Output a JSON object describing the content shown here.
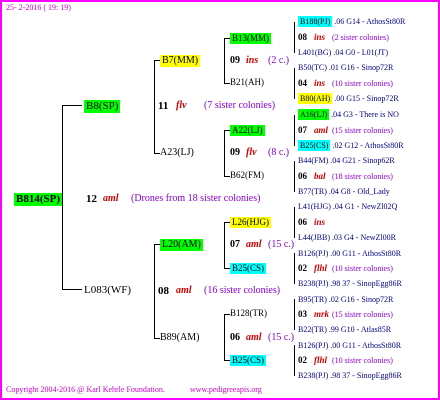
{
  "header": {
    "date": "25- 2-2016 ( 19: 19)"
  },
  "footer": {
    "copyright": "Copyright 2004-2016 @ Karl Kehrle Foundation.",
    "url": "www.pedigreeapis.org"
  },
  "root": {
    "id": "B814(SP)",
    "num": "12",
    "ins": "aml",
    "note": "(Drones from 18 sister colonies)"
  },
  "gen1": [
    {
      "id": "B8(SP)",
      "num": "11",
      "ins": "flv",
      "note": "(7 sister colonies)"
    },
    {
      "id": "L083(WF)",
      "num": "08",
      "ins": "aml",
      "note": "(16 sister colonies)"
    }
  ],
  "gen2": [
    {
      "id": "B7(MM)",
      "num": "09",
      "ins": "ins",
      "note": "(2 c.)"
    },
    {
      "id": "A23(LJ)",
      "num": "09",
      "ins": "flv",
      "note": "(8 c.)"
    },
    {
      "id": "L20(AM)",
      "num": "07",
      "ins": "aml",
      "note": "(15 c.)"
    },
    {
      "id": "B89(AM)",
      "num": "06",
      "ins": "aml",
      "note": "(15 c.)"
    }
  ],
  "gen3": [
    {
      "id": "B13(MM)",
      "num": "08",
      "ins": "ins",
      "note": "(2 sister colonies)"
    },
    {
      "id": "B21(AH)",
      "num": "04",
      "ins": "ins",
      "note": "(10 sister colonies)"
    },
    {
      "id": "A22(LJ)",
      "num": "07",
      "ins": "aml",
      "note": "(15 sister colonies)"
    },
    {
      "id": "B62(FM)",
      "num": "06",
      "ins": "bal",
      "note": "(18 sister colonies)"
    },
    {
      "id": "L26(HJG)",
      "num": "06",
      "ins": "ins",
      "note": ""
    },
    {
      "id": "B25(CS)",
      "num": "02",
      "ins": "flhl",
      "note": "(10 sister colonies)"
    },
    {
      "id": "B128(TR)",
      "num": "03",
      "ins": "mrk",
      "note": "(15 sister colonies)"
    },
    {
      "id": "B25(CS)",
      "num": "02",
      "ins": "flhl",
      "note": "(10 sister colonies)"
    }
  ],
  "gen4": [
    {
      "id": "B188(PJ)",
      "val": ".06",
      "tail": "G14 - AthosSt80R"
    },
    {
      "id": "L401(BG)",
      "val": ".04",
      "tail": "G0 - L01(JT)"
    },
    {
      "id": "B50(TC)",
      "val": ".01",
      "tail": "G16 - Sinop72R"
    },
    {
      "id": "B80(AH)",
      "val": ".00",
      "tail": "G15 - Sinop72R"
    },
    {
      "id": "A16(LJ)",
      "val": ".04",
      "tail": "G3 - There is NO"
    },
    {
      "id": "B25(CS)",
      "val": ".02",
      "tail": "G12 - AthosSt80R"
    },
    {
      "id": "B44(FM)",
      "val": ".04",
      "tail": "G21 - Sinop62R"
    },
    {
      "id": "B77(TR)",
      "val": ".04",
      "tail": "G8 - Old_Lady"
    },
    {
      "id": "L41(HJG)",
      "val": ".04",
      "tail": "G1 - NewZl02Q"
    },
    {
      "id": "L44(JBB)",
      "val": ".03",
      "tail": "G4 - NewZl00R"
    },
    {
      "id": "B126(PJ)",
      "val": ".00",
      "tail": "G11 - AthosSt80R"
    },
    {
      "id": "B238(PJ)",
      "val": ".98",
      "tail": "37 - SinopEgg86R"
    },
    {
      "id": "B95(TR)",
      "val": ".02",
      "tail": "G16 - Sinop72R"
    },
    {
      "id": "B22(TR)",
      "val": ".99",
      "tail": "G10 - Atlas85R"
    },
    {
      "id": "B126(PJ)",
      "val": ".00",
      "tail": "G11 - AthosSt80R"
    },
    {
      "id": "B238(PJ)",
      "val": ".98",
      "tail": "37 - SinopEgg86R"
    }
  ]
}
